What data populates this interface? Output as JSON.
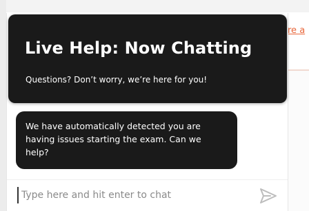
{
  "background": {
    "link_text": "re a",
    "accent_color": "#e8663a"
  },
  "chat": {
    "header": {
      "title": "Live Help: Now Chatting",
      "subtitle": "Questions? Don’t worry, we’re here for you!"
    },
    "messages": [
      {
        "sender": "agent",
        "text": "We have automatically detected you are having issues starting the exam. Can we help?"
      }
    ],
    "composer": {
      "placeholder": "Type here and hit enter to chat",
      "value": "",
      "send_icon": "send-icon"
    },
    "colors": {
      "header_bg": "#1a1a1a",
      "bubble_bg": "#1a1a1a",
      "text_on_dark": "#ffffff",
      "placeholder": "#8a8a8a",
      "send_icon": "#bdbdbd"
    }
  }
}
